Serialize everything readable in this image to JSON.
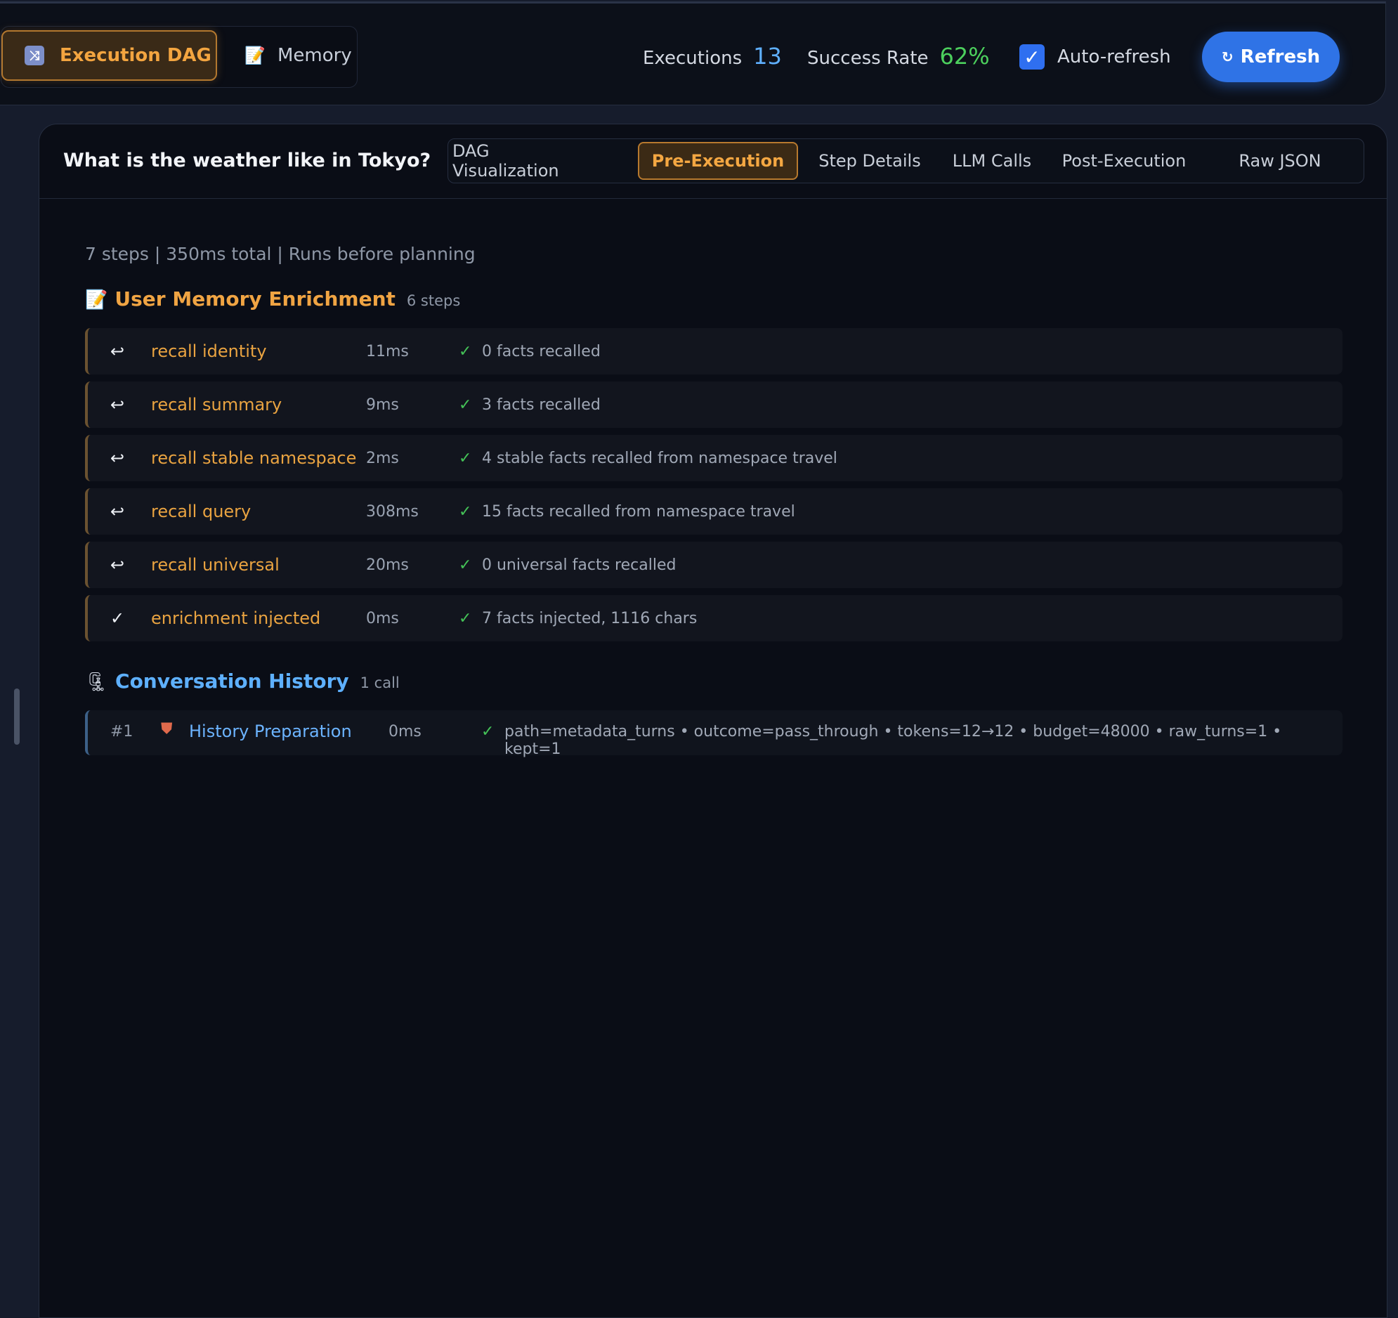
{
  "topbar": {
    "views": [
      {
        "label": "Execution DAG",
        "icon": "shuffle-icon",
        "glyph": "⤨"
      },
      {
        "label": "Memory",
        "icon": "memo-icon",
        "glyph": "📝"
      }
    ],
    "executions_label": "Executions",
    "executions_value": "13",
    "success_label": "Success Rate",
    "success_value": "62%",
    "autorefresh_label": "Auto-refresh",
    "autorefresh_checked": true,
    "refresh_label": "Refresh",
    "refresh_glyph": "↻"
  },
  "panel": {
    "query": "What is the weather like in Tokyo?",
    "tabs": [
      {
        "label": "DAG Visualization"
      },
      {
        "label": "Pre-Execution"
      },
      {
        "label": "Step Details"
      },
      {
        "label": "LLM Calls"
      },
      {
        "label": "Post-Execution"
      },
      {
        "label": "Raw JSON"
      }
    ],
    "active_tab": "Pre-Execution",
    "summary": "7 steps | 350ms total | Runs before planning",
    "memory_section": {
      "emoji": "📝",
      "title": "User Memory Enrichment",
      "count": "6 steps",
      "steps": [
        {
          "icon": "↩",
          "name": "recall identity",
          "time": "11ms",
          "check": "✓",
          "detail": "0 facts recalled"
        },
        {
          "icon": "↩",
          "name": "recall summary",
          "time": "9ms",
          "check": "✓",
          "detail": "3 facts recalled"
        },
        {
          "icon": "↩",
          "name": "recall stable namespace",
          "time": "2ms",
          "check": "✓",
          "detail": "4 stable facts recalled from namespace travel"
        },
        {
          "icon": "↩",
          "name": "recall query",
          "time": "308ms",
          "check": "✓",
          "detail": "15 facts recalled from namespace travel"
        },
        {
          "icon": "↩",
          "name": "recall universal",
          "time": "20ms",
          "check": "✓",
          "detail": "0 universal facts recalled"
        },
        {
          "icon": "✓",
          "name": "enrichment injected",
          "time": "0ms",
          "check": "✓",
          "detail": "7 facts injected, 1116 chars"
        }
      ]
    },
    "history_section": {
      "emoji": "🗜",
      "title": "Conversation History",
      "count": "1 call",
      "row": {
        "num": "#1",
        "icon": "⛊",
        "name": "History Preparation",
        "time": "0ms",
        "check": "✓",
        "detail": "path=metadata_turns • outcome=pass_through • tokens=12→12 • budget=48000 • raw_turns=1 • kept=1"
      }
    }
  },
  "colors": {
    "accent_orange": "#f0a443",
    "accent_blue": "#5eb0ff",
    "success_green": "#44c257",
    "primary_button": "#2f73e6"
  }
}
